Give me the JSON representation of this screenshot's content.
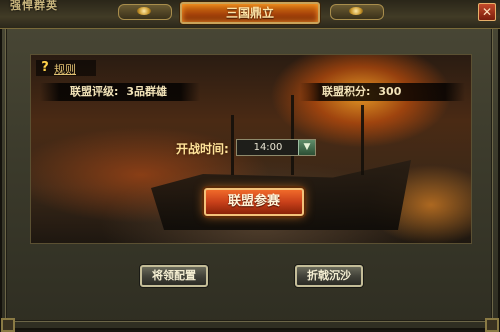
{
  "window": {
    "brand_text": "强悍群英",
    "title": "三国鼎立",
    "close_label": "✕"
  },
  "rules": {
    "icon_glyph": "?",
    "label": "规则"
  },
  "alliance": {
    "rating_label": "联盟评级:",
    "rating_value": "3品群雄",
    "points_label": "联盟积分:",
    "points_value": "300"
  },
  "battle_time": {
    "label": "开战时间:",
    "value": "14:00",
    "arrow": "▼"
  },
  "actions": {
    "join_label": "联盟参赛",
    "generals_label": "将领配置",
    "sands_label": "折戟沉沙"
  },
  "colors": {
    "title_plate": "#c2580e",
    "join_button": "#d9481e",
    "frame": "#3b3a2b"
  }
}
